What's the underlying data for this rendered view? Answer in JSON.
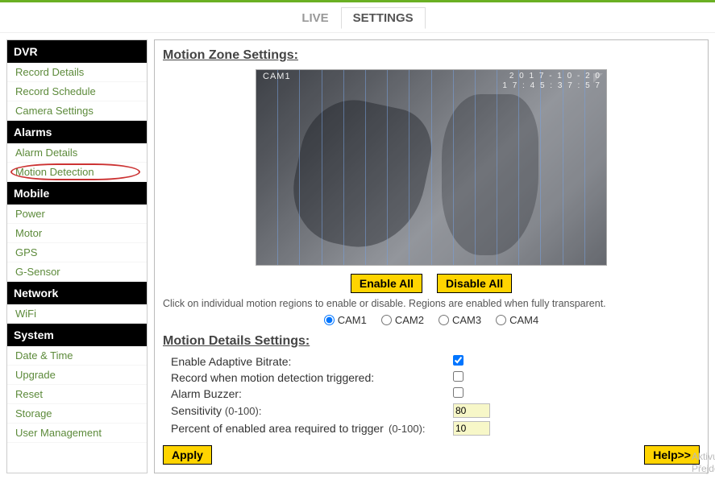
{
  "tabs": {
    "live": "LIVE",
    "settings": "SETTINGS"
  },
  "sidebar": {
    "dvr": {
      "title": "DVR",
      "items": [
        "Record Details",
        "Record Schedule",
        "Camera Settings"
      ]
    },
    "alarms": {
      "title": "Alarms",
      "items": [
        "Alarm Details",
        "Motion Detection"
      ]
    },
    "mobile": {
      "title": "Mobile",
      "items": [
        "Power",
        "Motor",
        "GPS",
        "G-Sensor"
      ]
    },
    "network": {
      "title": "Network",
      "items": [
        "WiFi"
      ]
    },
    "system": {
      "title": "System",
      "items": [
        "Date & Time",
        "Upgrade",
        "Reset",
        "Storage",
        "User Management"
      ]
    }
  },
  "main": {
    "zone_title": "Motion Zone Settings:",
    "cam_label": "CAM1",
    "timestamp_line1": "2 0 1 7 - 1 0 - 2 0",
    "timestamp_line2": "1 7 : 4 5 : 3 7 : 5 7",
    "enable_all": "Enable All",
    "disable_all": "Disable All",
    "hint": "Click on individual motion regions to enable or disable. Regions are enabled when fully transparent.",
    "cams": [
      "CAM1",
      "CAM2",
      "CAM3",
      "CAM4"
    ],
    "details_title": "Motion Details Settings:",
    "row_bitrate": "Enable Adaptive Bitrate:",
    "row_record": "Record when motion detection triggered:",
    "row_buzzer": "Alarm Buzzer:",
    "row_sens": "Sensitivity",
    "row_sens_range": "(0-100):",
    "row_pct": "Percent of enabled area required to trigger",
    "row_pct_range": "(0-100):",
    "val_sens": "80",
    "val_pct": "10",
    "apply": "Apply",
    "help": "Help>>",
    "watermark1": "Aktivujte W",
    "watermark2": "Přejděte do Na"
  }
}
